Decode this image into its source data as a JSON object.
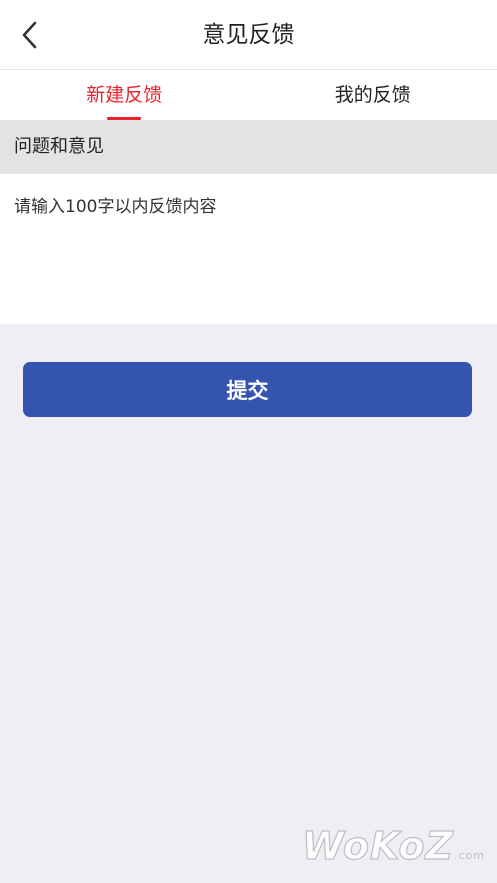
{
  "header": {
    "title": "意见反馈",
    "back_icon": "chevron-left-icon"
  },
  "tabs": [
    {
      "label": "新建反馈",
      "active": true
    },
    {
      "label": "我的反馈",
      "active": false
    }
  ],
  "section": {
    "label": "问题和意见"
  },
  "feedback": {
    "value": "",
    "placeholder": "请输入100字以内反馈内容"
  },
  "submit": {
    "label": "提交"
  },
  "watermark": {
    "text": "WoKoZ",
    "suffix": ".com"
  },
  "colors": {
    "accent_red": "#e8242e",
    "primary_button": "#3454b0",
    "page_background": "#efeef4",
    "section_header_background": "#e3e3e3"
  }
}
